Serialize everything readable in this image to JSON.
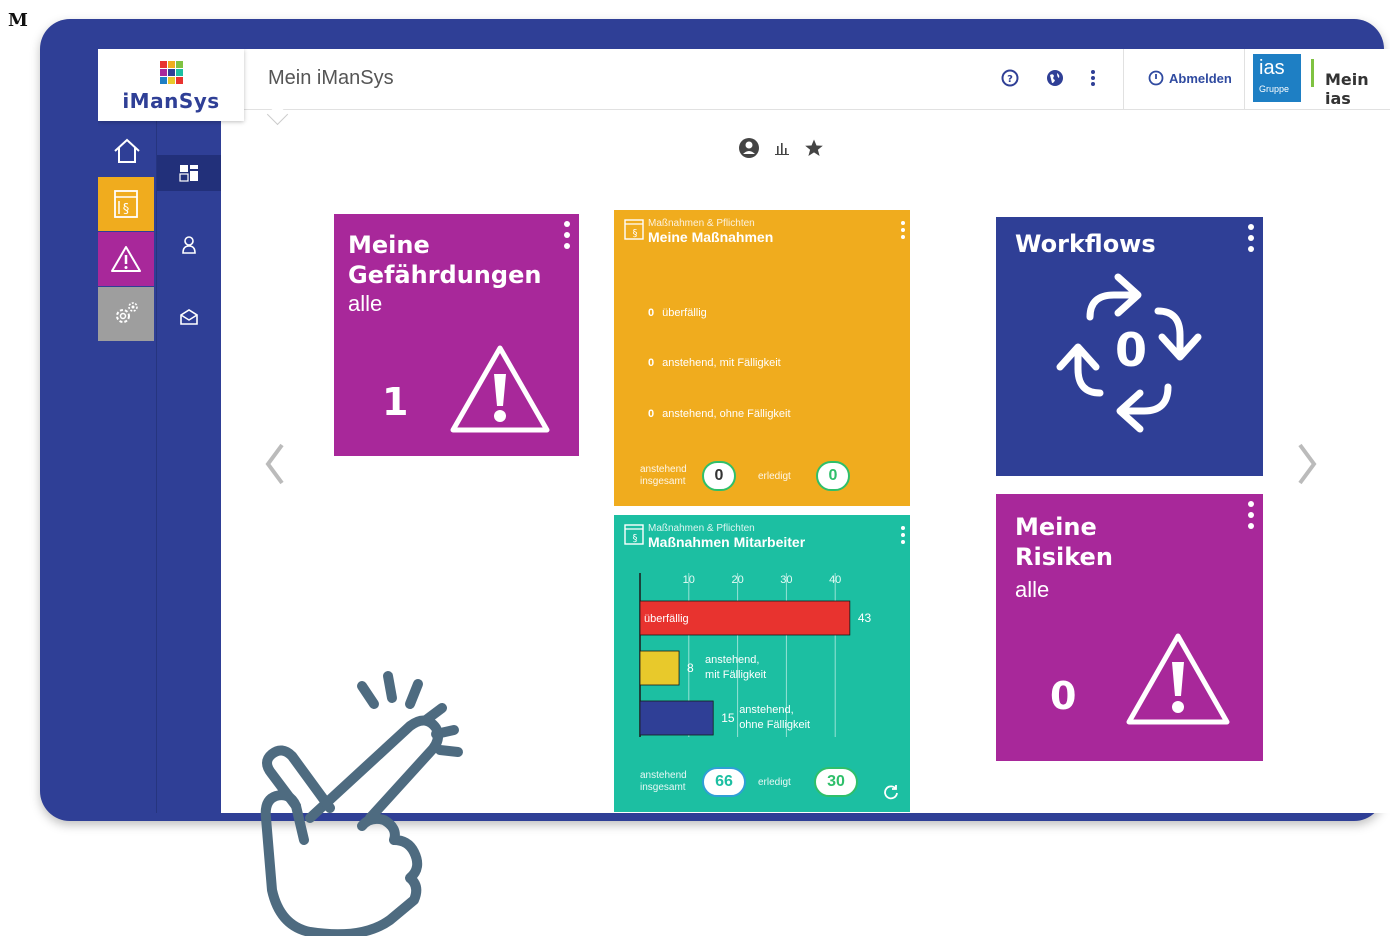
{
  "corner_letter": "M",
  "logo": {
    "text": "iManSys"
  },
  "header": {
    "title": "Mein iManSys",
    "icons": [
      "help-icon",
      "globe-icon",
      "more-vertical-icon"
    ],
    "logout_label": "Abmelden",
    "ias_logo": {
      "main": "ias",
      "sub": "Gruppe"
    },
    "mein_ias_label": "Mein ias"
  },
  "sidebar": {
    "primary": [
      {
        "name": "home-icon"
      },
      {
        "name": "law-book-icon",
        "color": "#f0ac1e"
      },
      {
        "name": "warning-icon",
        "color": "#a8289a"
      },
      {
        "name": "settings-icon",
        "color": "#9e9e9e"
      }
    ],
    "secondary": [
      "dashboard-icon",
      "user-icon",
      "mail-icon"
    ]
  },
  "view_switch": [
    "user-circle-icon",
    "bar-chart-icon",
    "star-icon"
  ],
  "tiles": {
    "gefaehrdungen": {
      "title_line1": "Meine",
      "title_line2": "Gefährdungen",
      "subtitle": "alle",
      "count": "1",
      "color": "#a8289a"
    },
    "massnahmen": {
      "category": "Maßnahmen & Pflichten",
      "title": "Meine Maßnahmen",
      "lines": [
        {
          "count": "0",
          "label": "überfällig"
        },
        {
          "count": "0",
          "label": "anstehend, mit Fälligkeit"
        },
        {
          "count": "0",
          "label": "anstehend, ohne Fälligkeit"
        }
      ],
      "footer": {
        "pending_label_1": "anstehend",
        "pending_label_2": "insgesamt",
        "pending_value": "0",
        "done_label": "erledigt",
        "done_value": "0"
      },
      "color": "#f0ac1e"
    },
    "workflows": {
      "title": "Workflows",
      "count": "0",
      "color": "#2f3f96"
    },
    "mitarbeiter": {
      "category": "Maßnahmen & Pflichten",
      "title": "Maßnahmen Mitarbeiter",
      "footer": {
        "pending_label_1": "anstehend",
        "pending_label_2": "insgesamt",
        "pending_value": "66",
        "done_label": "erledigt",
        "done_value": "30"
      },
      "color": "#1cbfa2"
    },
    "risiken": {
      "title_line1": "Meine",
      "title_line2": "Risiken",
      "subtitle": "alle",
      "count": "0",
      "color": "#a8289a"
    }
  },
  "chart_data": {
    "type": "bar",
    "orientation": "horizontal",
    "xlim": [
      0,
      45
    ],
    "ticks": [
      "10",
      "20",
      "30",
      "40"
    ],
    "categories": [
      "überfällig",
      "anstehend, mit Fälligkeit",
      "anstehend, ohne Fälligkeit"
    ],
    "values": [
      43,
      8,
      15
    ],
    "value_labels": [
      "43",
      "8",
      "15"
    ],
    "colors": [
      "#e8332f",
      "#e8c92b",
      "#2f3f96"
    ],
    "grid": true
  }
}
